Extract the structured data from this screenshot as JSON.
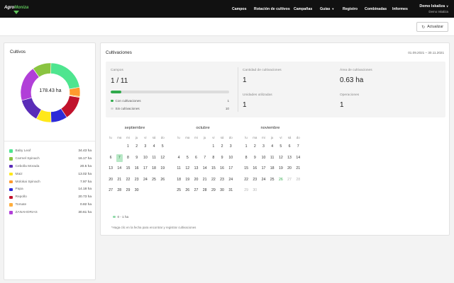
{
  "header": {
    "brand_part1": "Agro",
    "brand_part2": "Moniza",
    "nav": [
      {
        "label": "Campos"
      },
      {
        "label": "Rotación de cultivos"
      },
      {
        "label": "Campañas"
      },
      {
        "label": "Guías"
      },
      {
        "label": "Registro"
      },
      {
        "label": "Combinadas"
      },
      {
        "label": "Informes"
      }
    ],
    "user_name": "Demo Iskaliza",
    "user_org": "Demo Iskaliza"
  },
  "toolbar": {
    "refresh_label": "Actualizar",
    "refresh_icon": "refresh-icon"
  },
  "crops_card": {
    "title": "Cultivos",
    "total": "178.43 ha",
    "items": [
      {
        "name": "Baby Leaf",
        "value": "34.43 ha",
        "color": "#4ee58f"
      },
      {
        "name": "Carmel Spinach",
        "value": "16.17 ha",
        "color": "#8ac441"
      },
      {
        "name": "Cebolla Morada",
        "value": "20.5 ha",
        "color": "#5a2db8"
      },
      {
        "name": "Maiz",
        "value": "13.02 ha",
        "color": "#ffe81a"
      },
      {
        "name": "Molokai Spinach",
        "value": "7.97 ha",
        "color": "#ff9a2e"
      },
      {
        "name": "Papa",
        "value": "14.18 ha",
        "color": "#2d2ad8"
      },
      {
        "name": "Repollo",
        "value": "20.73 ha",
        "color": "#c1122c"
      },
      {
        "name": "Tomate",
        "value": "0.82 ha",
        "color": "#ffae3d"
      },
      {
        "name": "ZANAHORIAS",
        "value": "30.61 ha",
        "color": "#b13fd8"
      }
    ]
  },
  "cultivations_card": {
    "title": "Cultivaciones",
    "period": "01.09.2021 – 30.11.2021",
    "fields_label": "Campos",
    "fields_value": "1 / 11",
    "fields_progress": 0.09,
    "with_label": "Con cultivaciones",
    "with_value": "1",
    "with_color": "#2faa4b",
    "without_label": "Sin cultivaciones",
    "without_value": "10",
    "without_color": "#d5d5d5",
    "count_label": "Cantidad de cultivaciones",
    "count_value": "1",
    "area_label": "Área de cultivaciones",
    "area_value": "0.63 ha",
    "units_label": "Unidades utilizadas",
    "units_value": "1",
    "ops_label": "Operaciones",
    "ops_value": "1"
  },
  "calendar": {
    "weekdays": [
      "lu",
      "ma",
      "mi",
      "ju",
      "vi",
      "sá",
      "do"
    ],
    "months": [
      {
        "name": "septiembre",
        "rows": [
          [
            "",
            "",
            "1",
            "2",
            "3",
            "4",
            "5"
          ],
          [
            "6",
            "7",
            "8",
            "9",
            "10",
            "11",
            "12"
          ],
          [
            "13",
            "14",
            "15",
            "16",
            "17",
            "18",
            "19"
          ],
          [
            "20",
            "21",
            "22",
            "23",
            "24",
            "25",
            "26"
          ],
          [
            "27",
            "28",
            "29",
            "30",
            "",
            "",
            ""
          ]
        ]
      },
      {
        "name": "octubre",
        "rows": [
          [
            "",
            "",
            "",
            "",
            "1",
            "2",
            "3"
          ],
          [
            "4",
            "5",
            "6",
            "7",
            "8",
            "9",
            "10"
          ],
          [
            "11",
            "12",
            "13",
            "14",
            "15",
            "16",
            "17"
          ],
          [
            "18",
            "19",
            "20",
            "21",
            "22",
            "23",
            "24"
          ],
          [
            "25",
            "26",
            "27",
            "28",
            "29",
            "30",
            "31"
          ]
        ]
      },
      {
        "name": "noviembre",
        "rows": [
          [
            "1",
            "2",
            "3",
            "4",
            "5",
            "6",
            "7"
          ],
          [
            "8",
            "9",
            "10",
            "11",
            "12",
            "13",
            "14"
          ],
          [
            "15",
            "16",
            "17",
            "18",
            "19",
            "20",
            "21"
          ],
          [
            "22",
            "23",
            "24",
            "25",
            "26",
            "27",
            "28"
          ],
          [
            "29",
            "30",
            "",
            "",
            "",
            "",
            ""
          ]
        ]
      }
    ],
    "legend_label": "0 - 1 ha",
    "legend_color": "#8fd9a8",
    "hint": "*Haga clic en la fecha para encontrar y registrar cultivaciones"
  }
}
